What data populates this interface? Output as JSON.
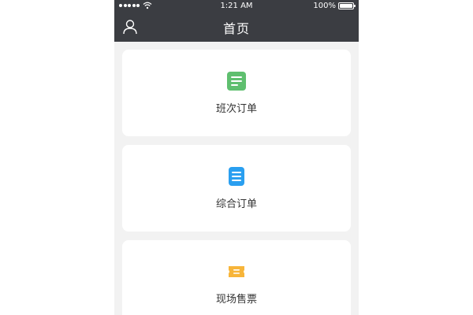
{
  "status_bar": {
    "time": "1:21 AM",
    "battery": "100%"
  },
  "header": {
    "title": "首页",
    "left_icon": "user-icon"
  },
  "cards": [
    {
      "label": "班次订单",
      "icon": "document-icon",
      "color": "#5fbf6f"
    },
    {
      "label": "综合订单",
      "icon": "list-icon",
      "color": "#2a9ff0"
    },
    {
      "label": "现场售票",
      "icon": "ticket-icon",
      "color": "#f7b53a"
    }
  ],
  "colors": {
    "header_bg": "#3b3d42",
    "page_bg": "#f2f2f2",
    "card_bg": "#ffffff"
  }
}
